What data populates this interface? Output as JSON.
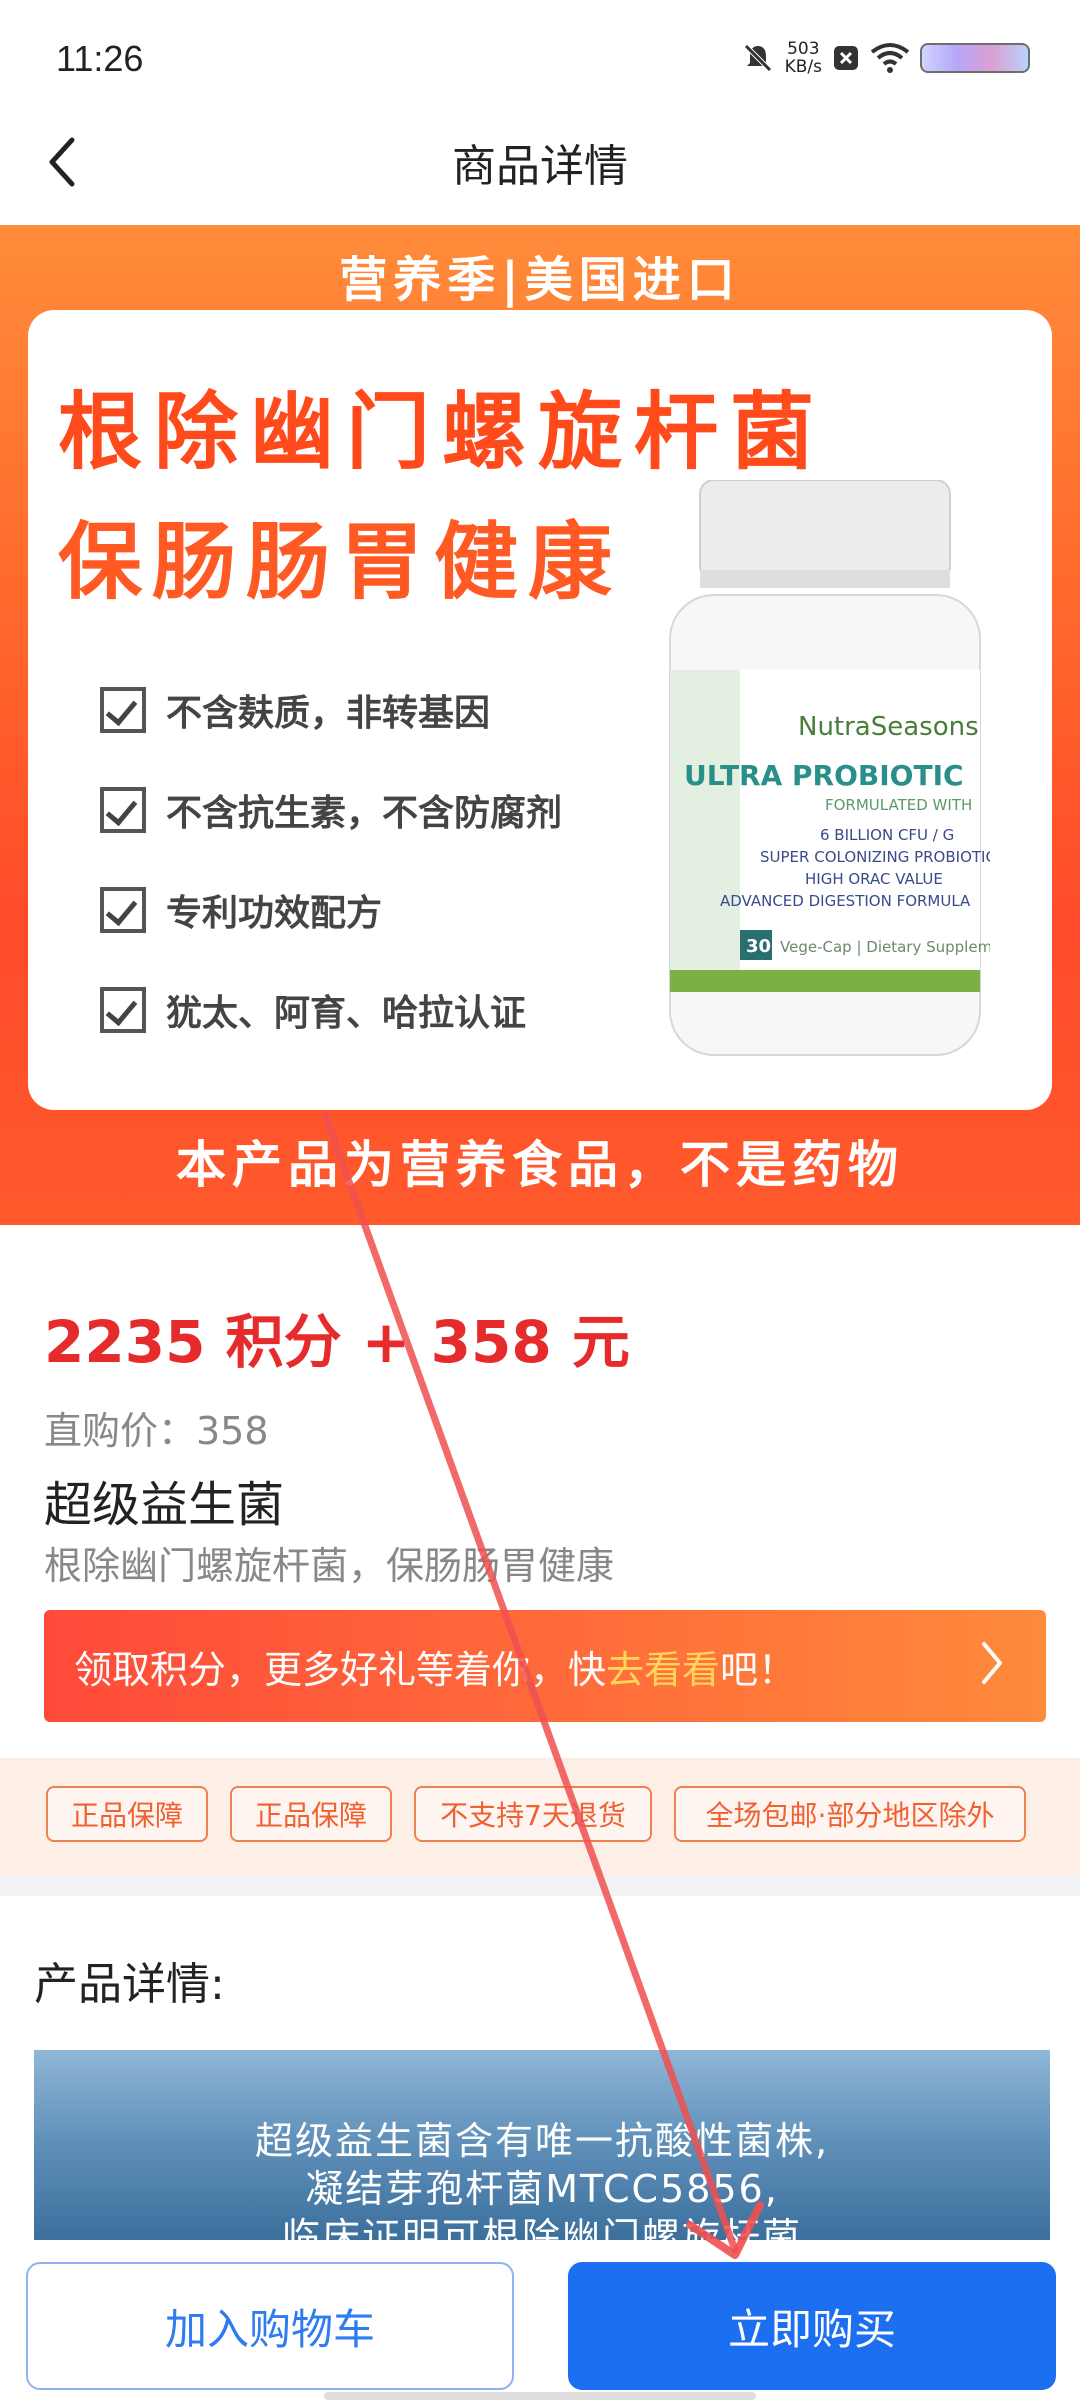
{
  "status_bar": {
    "time": "11:26",
    "net_speed_value": "503",
    "net_speed_unit": "KB/s",
    "icons": [
      "mute-icon",
      "x-icon",
      "wifi-icon",
      "battery-icon"
    ]
  },
  "nav": {
    "title": "商品详情",
    "back_icon": "chevron-left-icon"
  },
  "hero": {
    "top_text": "营养季|美国进口",
    "headline_1": "根除幽门螺旋杆菌",
    "headline_2": "保肠肠胃健康",
    "features": [
      "不含麸质，非转基因",
      "不含抗生素，不含防腐剂",
      "专利功效配方",
      "犹太、阿育、哈拉认证"
    ],
    "bottle_brand": "NutraSeasons",
    "bottle_title": "ULTRA PROBIOTIC",
    "bottle_sub": "FORMULATED WITH",
    "bottle_lines": [
      "6 BILLION CFU / G",
      "SUPER COLONIZING PROBIOTIC",
      "HIGH ORAC VALUE",
      "ADVANCED DIGESTION FORMULA"
    ],
    "bottle_count": "30",
    "bottle_footer": "Vege-Cap | Dietary Supplement",
    "bottom_text": "本产品为营养食品，不是药物"
  },
  "product": {
    "price": "2235 积分 + 358 元",
    "direct_price": "直购价：358",
    "name": "超级益生菌",
    "desc": "根除幽门螺旋杆菌，保肠肠胃健康"
  },
  "promo": {
    "text_a": "领取积分，更多好礼等着你，快",
    "text_hl": "去看看",
    "text_b": "吧！"
  },
  "tags": [
    "正品保障",
    "正品保障",
    "不支持7天退货",
    "全场包邮·部分地区除外"
  ],
  "details": {
    "title": "产品详情:",
    "lines": [
      "超级益生菌含有唯一抗酸性菌株,",
      "凝结芽孢杆菌MTCC5856,",
      "临床证明可根除幽门螺旋杆菌"
    ]
  },
  "actions": {
    "add_to_cart": "加入购物车",
    "buy_now": "立即购买"
  },
  "colors": {
    "accent_red": "#e52b2b",
    "primary_blue": "#1c6ff0",
    "hero_orange": "#ff6b2c"
  }
}
